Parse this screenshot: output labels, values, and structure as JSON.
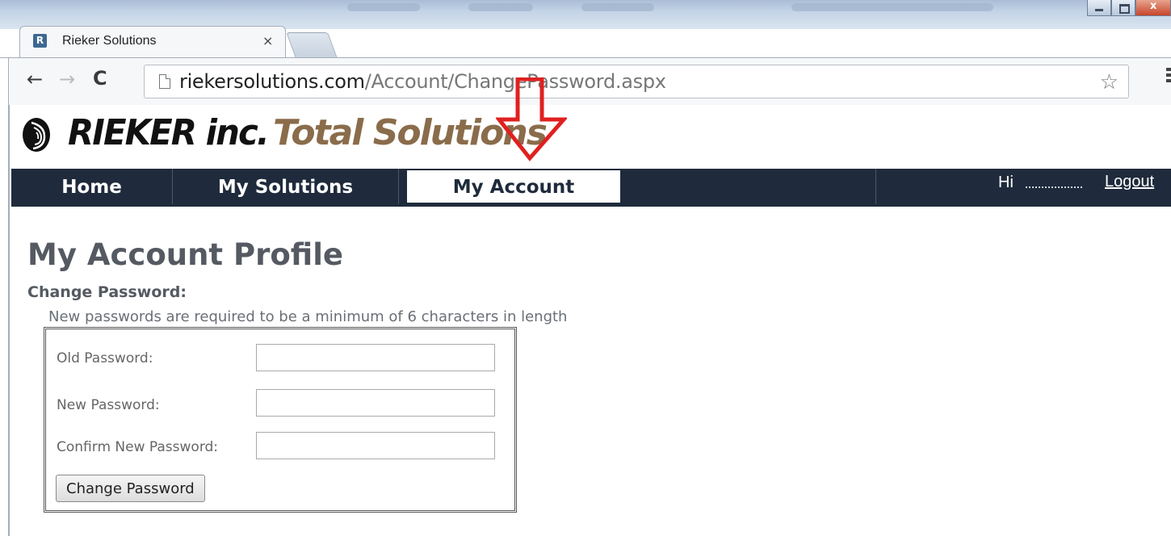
{
  "browser": {
    "tab_title": "Rieker Solutions",
    "tab_close": "×",
    "url_host": "riekersolutions.com",
    "url_path": "/Account/ChangePassword.aspx"
  },
  "site": {
    "logo_brand": "RIEKER inc.",
    "logo_tagline": "Total Solutions",
    "nav": {
      "home": "Home",
      "solutions": "My Solutions",
      "account": "My Account",
      "greeting": "Hi",
      "logout": "Logout"
    }
  },
  "page": {
    "title": "My Account Profile",
    "section": "Change Password:",
    "hint": "New passwords are required to be a minimum of 6 characters in length",
    "form": {
      "old_label": "Old Password:",
      "new_label": "New Password:",
      "confirm_label": "Confirm New Password:",
      "old_value": "",
      "new_value": "",
      "confirm_value": "",
      "submit_label": "Change Password"
    }
  },
  "annotation": {
    "arrow_color": "#e02020"
  },
  "colors": {
    "nav_bg": "#1f2b3c",
    "heading": "#555a62",
    "brand_brown": "#8a6c4b"
  }
}
